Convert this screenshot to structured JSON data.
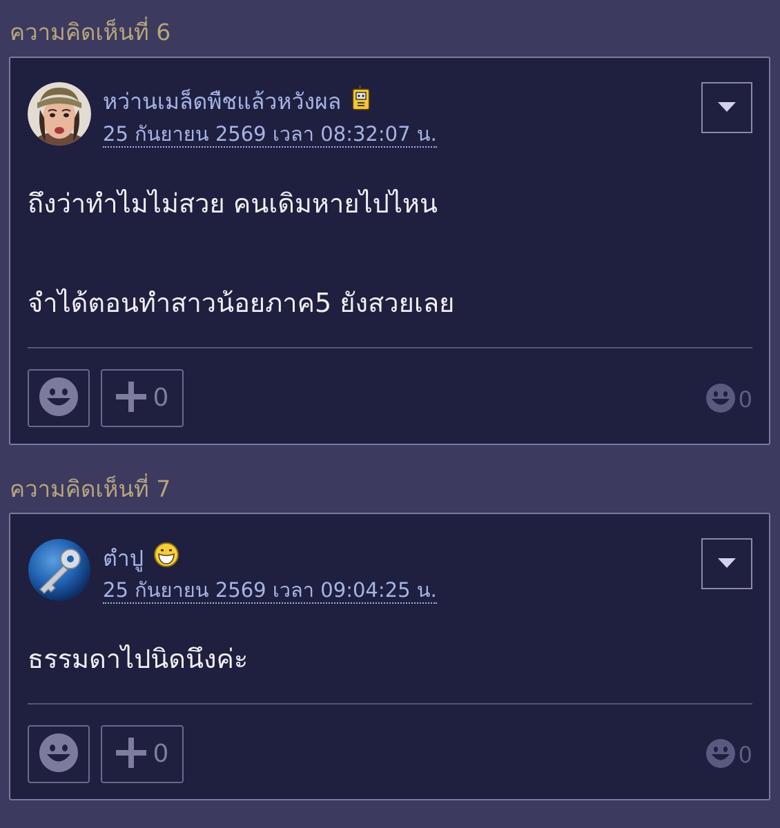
{
  "comments": [
    {
      "heading": "ความคิดเห็นที่ 6",
      "username": "หว่านเมล็ดพืชแล้วหวังผล",
      "avatar_icon": "user-photo-avatar",
      "badge_icon": "walkie-talkie-badge-icon",
      "timestamp": "25 กันยายน 2569 เวลา 08:32:07 น.",
      "body": [
        "ถึงว่าทำไมไม่สวย คนเดิมหายไปไหน",
        "จำได้ตอนทำสาวน้อยภาค5 ยังสวยเลย"
      ],
      "plus_count": "0",
      "reaction_count": "0"
    },
    {
      "heading": "ความคิดเห็นที่ 7",
      "username": "ตำปู",
      "avatar_icon": "key-avatar-icon",
      "badge_icon": "grin-emoji-badge-icon",
      "timestamp": "25 กันยายน 2569 เวลา 09:04:25 น.",
      "body": [
        "ธรรมดาไปนิดนึงค่ะ"
      ],
      "plus_count": "0",
      "reaction_count": "0"
    }
  ],
  "colors": {
    "page_background": "#3c3a5e",
    "card_background": "#1f1f3f",
    "heading": "#b6a57f",
    "link": "#a6b4e6",
    "body_text": "#eeeef4"
  }
}
